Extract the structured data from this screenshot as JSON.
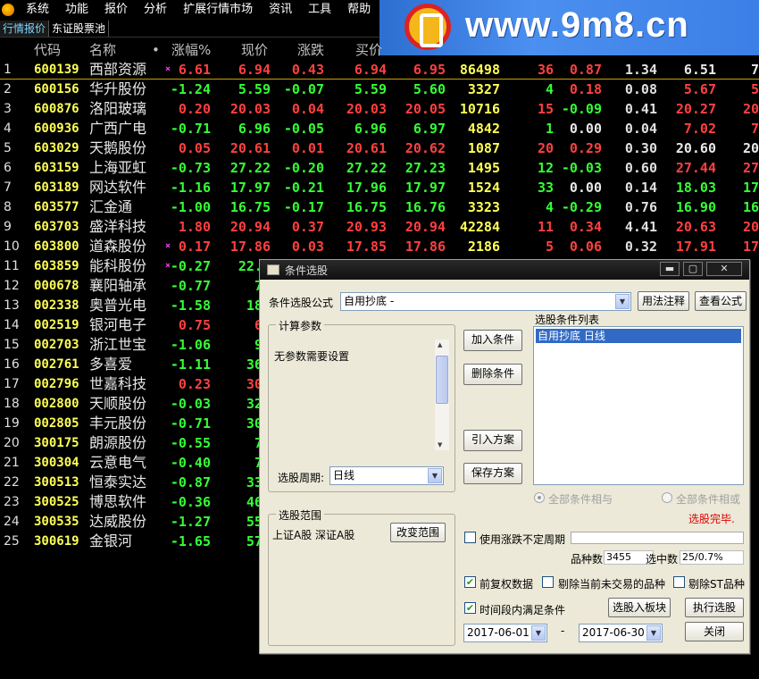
{
  "menu": [
    "系统",
    "功能",
    "报价",
    "分析",
    "扩展行情市场",
    "资讯",
    "工具",
    "帮助"
  ],
  "watermark": "www.9m8.cn",
  "tabs": [
    "行情报价",
    "东证股票池"
  ],
  "columns": {
    "code": "代码",
    "name": "名称",
    "dot": "•",
    "chg_pct": "涨幅%",
    "price": "现价",
    "change": "涨跌",
    "buy": "买价"
  },
  "rows": [
    {
      "i": "1",
      "code": "600139",
      "name": "西部资源",
      "mark": "×",
      "chg": "6.61",
      "price": "6.94",
      "diff": "0.43",
      "buy": "6.94",
      "sell": "6.95",
      "vol": "86498",
      "cur": "36",
      "spd": "0.87",
      "turn": "1.34",
      "pe": "6.51",
      "x": "7",
      "dir": "red",
      "pec": "white"
    },
    {
      "i": "2",
      "code": "600156",
      "name": "华升股份",
      "mark": "",
      "chg": "-1.24",
      "price": "5.59",
      "diff": "-0.07",
      "buy": "5.59",
      "sell": "5.60",
      "vol": "3327",
      "cur": "4",
      "spd": "0.18",
      "turn": "0.08",
      "pe": "5.67",
      "x": "5",
      "dir": "green",
      "pec": "red"
    },
    {
      "i": "3",
      "code": "600876",
      "name": "洛阳玻璃",
      "mark": "",
      "chg": "0.20",
      "price": "20.03",
      "diff": "0.04",
      "buy": "20.03",
      "sell": "20.05",
      "vol": "10716",
      "cur": "15",
      "spd": "-0.09",
      "turn": "0.41",
      "pe": "20.27",
      "x": "20",
      "dir": "red",
      "pec": "red"
    },
    {
      "i": "4",
      "code": "600936",
      "name": "广西广电",
      "mark": "",
      "chg": "-0.71",
      "price": "6.96",
      "diff": "-0.05",
      "buy": "6.96",
      "sell": "6.97",
      "vol": "4842",
      "cur": "1",
      "spd": "0.00",
      "turn": "0.04",
      "pe": "7.02",
      "x": "7",
      "dir": "green",
      "pec": "red"
    },
    {
      "i": "5",
      "code": "603029",
      "name": "天鹅股份",
      "mark": "",
      "chg": "0.05",
      "price": "20.61",
      "diff": "0.01",
      "buy": "20.61",
      "sell": "20.62",
      "vol": "1087",
      "cur": "20",
      "spd": "0.29",
      "turn": "0.30",
      "pe": "20.60",
      "x": "20",
      "dir": "red",
      "pec": "white"
    },
    {
      "i": "6",
      "code": "603159",
      "name": "上海亚虹",
      "mark": "",
      "chg": "-0.73",
      "price": "27.22",
      "diff": "-0.20",
      "buy": "27.22",
      "sell": "27.23",
      "vol": "1495",
      "cur": "12",
      "spd": "-0.03",
      "turn": "0.60",
      "pe": "27.44",
      "x": "27",
      "dir": "green",
      "pec": "red"
    },
    {
      "i": "7",
      "code": "603189",
      "name": "网达软件",
      "mark": "",
      "chg": "-1.16",
      "price": "17.97",
      "diff": "-0.21",
      "buy": "17.96",
      "sell": "17.97",
      "vol": "1524",
      "cur": "33",
      "spd": "0.00",
      "turn": "0.14",
      "pe": "18.03",
      "x": "17",
      "dir": "green",
      "pec": "green"
    },
    {
      "i": "8",
      "code": "603577",
      "name": "汇金通",
      "mark": "",
      "chg": "-1.00",
      "price": "16.75",
      "diff": "-0.17",
      "buy": "16.75",
      "sell": "16.76",
      "vol": "3323",
      "cur": "4",
      "spd": "-0.29",
      "turn": "0.76",
      "pe": "16.90",
      "x": "16",
      "dir": "green",
      "pec": "green"
    },
    {
      "i": "9",
      "code": "603703",
      "name": "盛洋科技",
      "mark": "",
      "chg": "1.80",
      "price": "20.94",
      "diff": "0.37",
      "buy": "20.93",
      "sell": "20.94",
      "vol": "42284",
      "cur": "11",
      "spd": "0.34",
      "turn": "4.41",
      "pe": "20.63",
      "x": "20",
      "dir": "red",
      "pec": "red"
    },
    {
      "i": "10",
      "code": "603800",
      "name": "道森股份",
      "mark": "×",
      "chg": "0.17",
      "price": "17.86",
      "diff": "0.03",
      "buy": "17.85",
      "sell": "17.86",
      "vol": "2186",
      "cur": "5",
      "spd": "0.06",
      "turn": "0.32",
      "pe": "17.91",
      "x": "17",
      "dir": "red",
      "pec": "red"
    },
    {
      "i": "11",
      "code": "603859",
      "name": "能科股份",
      "mark": "×",
      "chg": "-0.27",
      "price": "22.0",
      "dir": "green"
    },
    {
      "i": "12",
      "code": "000678",
      "name": "襄阳轴承",
      "mark": "",
      "chg": "-0.77",
      "price": "7.",
      "dir": "green"
    },
    {
      "i": "13",
      "code": "002338",
      "name": "奥普光电",
      "mark": "",
      "chg": "-1.58",
      "price": "18.",
      "dir": "green"
    },
    {
      "i": "14",
      "code": "002519",
      "name": "银河电子",
      "mark": "",
      "chg": "0.75",
      "price": "6.",
      "dir": "red"
    },
    {
      "i": "15",
      "code": "002703",
      "name": "浙江世宝",
      "mark": "",
      "chg": "-1.06",
      "price": "9.",
      "dir": "green"
    },
    {
      "i": "16",
      "code": "002761",
      "name": "多喜爱",
      "mark": "",
      "chg": "-1.11",
      "price": "36.",
      "dir": "green"
    },
    {
      "i": "17",
      "code": "002796",
      "name": "世嘉科技",
      "mark": "",
      "chg": "0.23",
      "price": "30.",
      "dir": "red"
    },
    {
      "i": "18",
      "code": "002800",
      "name": "天顺股份",
      "mark": "",
      "chg": "-0.03",
      "price": "32.",
      "dir": "green"
    },
    {
      "i": "19",
      "code": "002805",
      "name": "丰元股份",
      "mark": "",
      "chg": "-0.71",
      "price": "30.",
      "dir": "green"
    },
    {
      "i": "20",
      "code": "300175",
      "name": "朗源股份",
      "mark": "",
      "chg": "-0.55",
      "price": "7.",
      "dir": "green"
    },
    {
      "i": "21",
      "code": "300304",
      "name": "云意电气",
      "mark": "",
      "chg": "-0.40",
      "price": "7.",
      "dir": "green"
    },
    {
      "i": "22",
      "code": "300513",
      "name": "恒泰实达",
      "mark": "",
      "chg": "-0.87",
      "price": "33.",
      "dir": "green"
    },
    {
      "i": "23",
      "code": "300525",
      "name": "博思软件",
      "mark": "",
      "chg": "-0.36",
      "price": "46.",
      "dir": "green"
    },
    {
      "i": "24",
      "code": "300535",
      "name": "达威股份",
      "mark": "",
      "chg": "-1.27",
      "price": "55.",
      "dir": "green"
    },
    {
      "i": "25",
      "code": "300619",
      "name": "金银河",
      "mark": "",
      "chg": "-1.65",
      "price": "57.",
      "dir": "green"
    }
  ],
  "dialog": {
    "title": "条件选股",
    "window_buttons": {
      "minimize": "▬",
      "maximize": "▢",
      "close": "✕"
    },
    "formula_label": "条件选股公式",
    "formula_value": "自用抄底       -",
    "btn_usage": "用法注释",
    "btn_view_formula": "查看公式",
    "params_group": "计算参数",
    "params_text": "无参数需要设置",
    "period_label": "选股周期:",
    "period_value": "日线",
    "btn_add": "加入条件",
    "btn_delete": "删除条件",
    "btn_import": "引入方案",
    "btn_save": "保存方案",
    "list_title": "选股条件列表",
    "list_items": [
      "自用抄底   日线"
    ],
    "radio_and": "全部条件相与",
    "radio_or": "全部条件相或",
    "status": "选股完毕.",
    "range_group": "选股范围",
    "range_text": "上证A股  深证A股",
    "btn_change_range": "改变范围",
    "chk_uncertain": "使用涨跌不定周期",
    "count_label": "品种数",
    "count_value": "3455",
    "selected_label": "选中数",
    "selected_value": "25/0.7%",
    "chk_adjust": "前复权数据",
    "chk_exclude_untraded": "剔除当前未交易的品种",
    "chk_exclude_st": "剔除ST品种",
    "chk_period": "时间段内满足条件",
    "btn_to_block": "选股入板块",
    "btn_execute": "执行选股",
    "date_from": "2017-06-01",
    "date_sep": "-",
    "date_to": "2017-06-30",
    "btn_close": "关闭"
  }
}
